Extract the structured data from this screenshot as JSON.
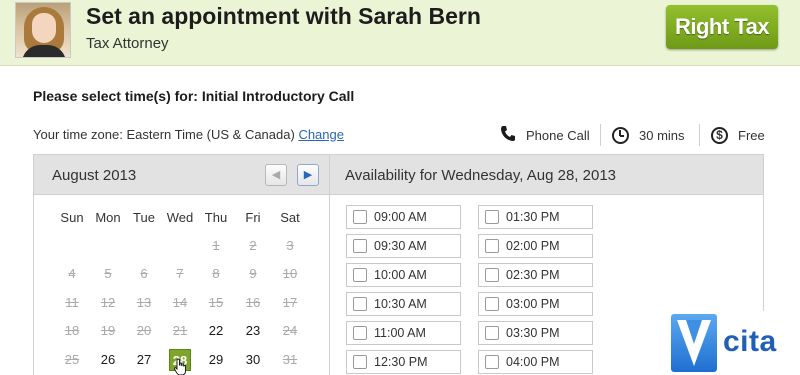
{
  "header": {
    "title": "Set an appointment with Sarah Bern",
    "subtitle": "Tax Attorney",
    "brand_logo": "Right Tax",
    "brand_color": "#7fab22"
  },
  "booking": {
    "prompt": "Please select time(s) for: Initial Introductory Call",
    "timezone_label": "Your time zone: Eastern Time (US & Canada)",
    "timezone_change": "Change",
    "meeting_type": "Phone Call",
    "meeting_type_icon": "phone-icon",
    "duration": "30 mins",
    "duration_icon": "clock-icon",
    "price": "Free",
    "price_icon": "dollar-icon"
  },
  "calendar": {
    "month_label": "August 2013",
    "prev_icon": "chevron-left-icon",
    "next_icon": "chevron-right-icon",
    "weekdays": [
      "Sun",
      "Mon",
      "Tue",
      "Wed",
      "Thu",
      "Fri",
      "Sat"
    ],
    "weeks": [
      [
        "",
        "",
        "",
        "",
        "1",
        "2",
        "3"
      ],
      [
        "4",
        "5",
        "6",
        "7",
        "8",
        "9",
        "10"
      ],
      [
        "11",
        "12",
        "13",
        "14",
        "15",
        "16",
        "17"
      ],
      [
        "18",
        "19",
        "20",
        "21",
        "22",
        "23",
        "24"
      ],
      [
        "25",
        "26",
        "27",
        "28",
        "29",
        "30",
        "31"
      ]
    ],
    "past_days": [
      "1",
      "2",
      "3",
      "4",
      "5",
      "6",
      "7",
      "8",
      "9",
      "10",
      "11",
      "12",
      "13",
      "14",
      "15",
      "16",
      "17",
      "18",
      "19",
      "20",
      "21",
      "24",
      "25",
      "31"
    ],
    "selected_day": "28",
    "selected_color": "#7ea52b"
  },
  "availability": {
    "title": "Availability for Wednesday, Aug 28, 2013",
    "left_slots": [
      "09:00 AM",
      "09:30 AM",
      "10:00 AM",
      "10:30 AM",
      "11:00 AM",
      "12:30 PM"
    ],
    "right_slots": [
      "01:30 PM",
      "02:00 PM",
      "02:30 PM",
      "03:00 PM",
      "03:30 PM",
      "04:00 PM"
    ]
  },
  "watermark": {
    "text": "cita",
    "logo": "vcita-logo"
  }
}
